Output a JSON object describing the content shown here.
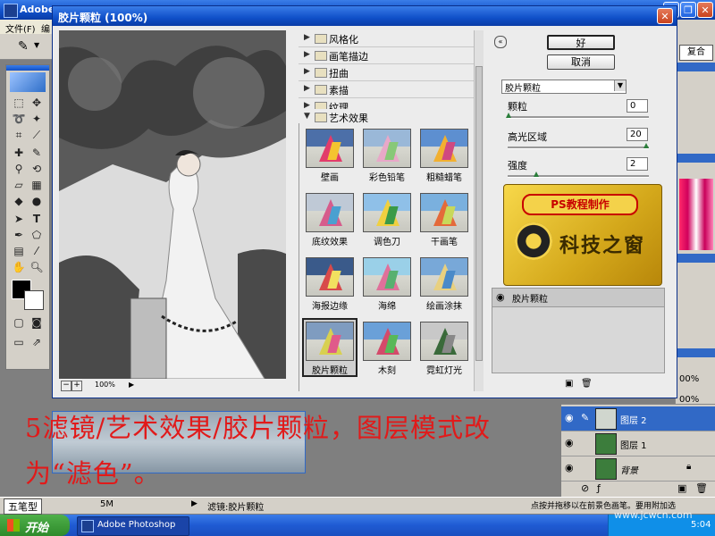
{
  "ps_app": {
    "title": "Adobe I",
    "menu": [
      "文件(F)",
      "编"
    ],
    "dock_tab": "复合"
  },
  "filter_dialog": {
    "title": "胶片颗粒 (100%)",
    "zoom": "100%",
    "categories": [
      {
        "label": "风格化",
        "expanded": false
      },
      {
        "label": "画笔描边",
        "expanded": false
      },
      {
        "label": "扭曲",
        "expanded": false
      },
      {
        "label": "素描",
        "expanded": false
      },
      {
        "label": "纹理",
        "expanded": false
      },
      {
        "label": "艺术效果",
        "expanded": true
      }
    ],
    "effects": [
      {
        "label": "壁画"
      },
      {
        "label": "彩色铅笔"
      },
      {
        "label": "粗糙蜡笔"
      },
      {
        "label": "底纹效果"
      },
      {
        "label": "调色刀"
      },
      {
        "label": "干画笔"
      },
      {
        "label": "海报边缘"
      },
      {
        "label": "海绵"
      },
      {
        "label": "绘画涂抹"
      },
      {
        "label": "胶片颗粒",
        "selected": true
      },
      {
        "label": "木刻"
      },
      {
        "label": "霓虹灯光"
      }
    ],
    "ok_label": "好",
    "cancel_label": "取消",
    "selected_filter": "胶片颗粒",
    "params": [
      {
        "label": "颗粒",
        "value": "0",
        "fraction": 0.0
      },
      {
        "label": "高光区域",
        "value": "20",
        "fraction": 1.0
      },
      {
        "label": "强度",
        "value": "2",
        "fraction": 0.2
      }
    ],
    "logo": {
      "line1": "PS教程制作",
      "line2": "科技之窗"
    },
    "effect_layer": "胶片颗粒"
  },
  "layers": [
    {
      "name": "图层 2",
      "selected": true
    },
    {
      "name": "图层 1",
      "selected": false
    },
    {
      "name": "背景",
      "selected": false
    }
  ],
  "right_panel_values": [
    "00%",
    "00%"
  ],
  "caption": {
    "line1": "5滤镜/艺术效果/胶片颗粒，图层模式改",
    "line2": "为“滤色”。"
  },
  "status": {
    "ime": "五笔型",
    "doc_size": "5M",
    "filter_text": "滤镜:胶片颗粒",
    "hint": "点按并拖移以在前景色画笔。要用附加选"
  },
  "taskbar": {
    "start": "开始",
    "task": "Adobe Photoshop",
    "clock": "5:04"
  },
  "watermark": "www.jcwcn.com",
  "colors": {
    "xp_blue": "#0f4fc8",
    "caption_red": "#e11a1a",
    "dialog_bg": "#ececec",
    "selection": "#3169c6"
  }
}
